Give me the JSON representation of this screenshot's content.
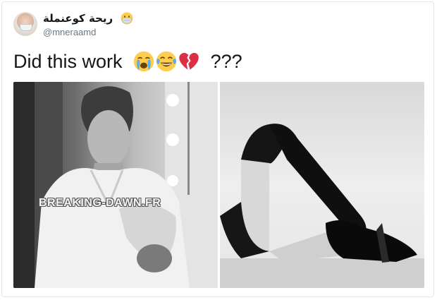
{
  "user": {
    "display_name": "ريحة كوعنملة",
    "handle": "@mneraamd",
    "name_emoji": "mask-emoji"
  },
  "tweet": {
    "text": "Did this work",
    "emojis": [
      "crying-face-emoji",
      "tears-of-joy-emoji",
      "broken-heart-emoji"
    ],
    "after_text": "???"
  },
  "media": {
    "left_photo": "man-in-white-shirt-photo",
    "right_photo": "legs-in-black-boots-photo",
    "watermark": "BREAKING-DAWN.FR"
  }
}
